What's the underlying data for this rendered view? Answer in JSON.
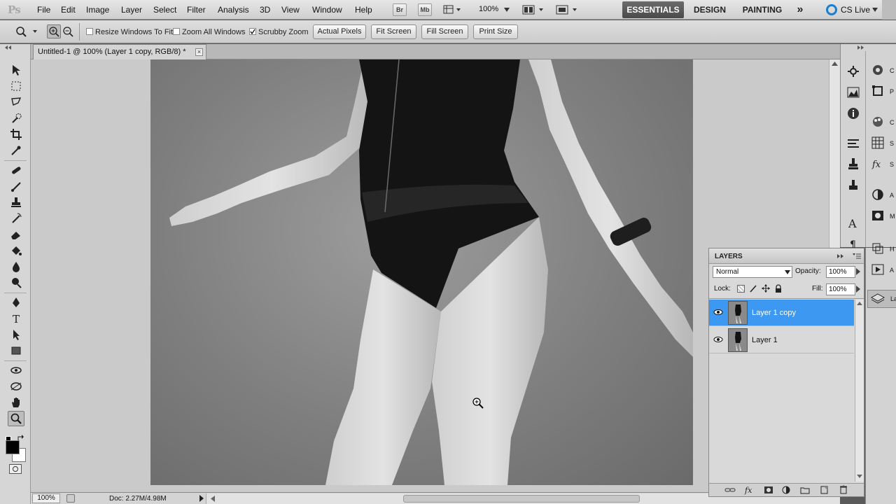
{
  "app": {
    "logo": "Ps"
  },
  "menu": [
    "File",
    "Edit",
    "Image",
    "Layer",
    "Select",
    "Filter",
    "Analysis",
    "3D",
    "View",
    "Window",
    "Help"
  ],
  "menubar": {
    "bridge_label": "Br",
    "minibridge_label": "Mb",
    "zoom_level": "100%",
    "workspaces": [
      "ESSENTIALS",
      "DESIGN",
      "PAINTING"
    ],
    "more_workspaces": "»",
    "cs_live": "CS Live"
  },
  "options": {
    "resize_windows": {
      "label": "Resize Windows To Fit",
      "checked": false
    },
    "zoom_all": {
      "label": "Zoom All Windows",
      "checked": false
    },
    "scrubby_zoom": {
      "label": "Scrubby Zoom",
      "checked": true
    },
    "buttons": [
      "Actual Pixels",
      "Fit Screen",
      "Fill Screen",
      "Print Size"
    ]
  },
  "document": {
    "tab_title": "Untitled-1 @ 100% (Layer 1 copy, RGB/8) *",
    "close_glyph": "×"
  },
  "status": {
    "zoom": "100%",
    "doc_info": "Doc: 2.27M/4.98M"
  },
  "layers_panel": {
    "tab": "LAYERS",
    "blend_mode": "Normal",
    "opacity_label": "Opacity:",
    "opacity_value": "100%",
    "lock_label": "Lock:",
    "fill_label": "Fill:",
    "fill_value": "100%",
    "layers": [
      {
        "name": "Layer 1 copy",
        "selected": true,
        "visible": true
      },
      {
        "name": "Layer 1",
        "selected": false,
        "visible": true
      }
    ]
  },
  "right_dock_labels": [
    "C",
    "P",
    "C",
    "S",
    "S",
    "A",
    "M",
    "H",
    "A",
    "La"
  ],
  "colors": {
    "selection_blue": "#3c98f0",
    "workspace_active": "#555555"
  }
}
